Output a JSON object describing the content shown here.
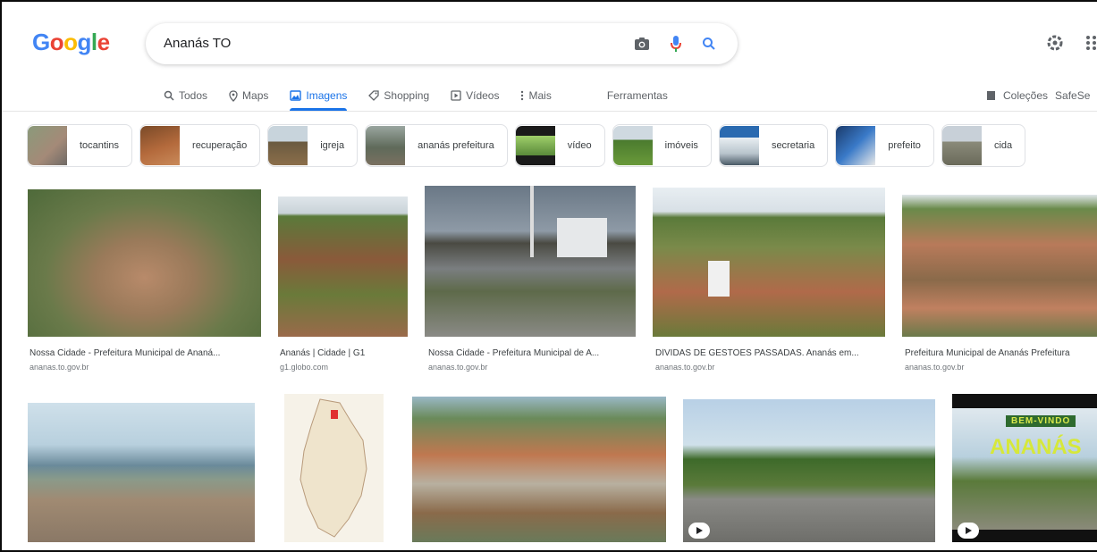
{
  "logo": {
    "letters": [
      "G",
      "o",
      "o",
      "g",
      "l",
      "e"
    ],
    "colors": [
      "#4285f4",
      "#ea4335",
      "#fbbc05",
      "#4285f4",
      "#34a853",
      "#ea4335"
    ]
  },
  "search": {
    "value": "Ananás TO"
  },
  "icons": {
    "camera": "camera-icon",
    "mic": "mic-icon",
    "search": "search-icon",
    "settings": "gear-icon",
    "apps": "apps-grid-icon"
  },
  "tabs": [
    {
      "label": "Todos",
      "icon": "search-icon",
      "active": false
    },
    {
      "label": "Maps",
      "icon": "map-pin-icon",
      "active": false
    },
    {
      "label": "Imagens",
      "icon": "image-icon",
      "active": true
    },
    {
      "label": "Shopping",
      "icon": "tag-icon",
      "active": false
    },
    {
      "label": "Vídeos",
      "icon": "video-icon",
      "active": false
    },
    {
      "label": "Mais",
      "icon": "more-icon",
      "active": false
    }
  ],
  "tools_label": "Ferramentas",
  "collections_label": "Coleções",
  "safesearch_label": "SafeSe",
  "chips": [
    {
      "label": "tocantins"
    },
    {
      "label": "recuperação"
    },
    {
      "label": "igreja"
    },
    {
      "label": "ananás prefeitura"
    },
    {
      "label": "vídeo"
    },
    {
      "label": "imóveis"
    },
    {
      "label": "secretaria"
    },
    {
      "label": "prefeito"
    },
    {
      "label": "cida"
    }
  ],
  "results_row1": [
    {
      "title": "Nossa Cidade - Prefeitura Municipal de Ananá...",
      "source": "ananas.to.gov.br"
    },
    {
      "title": "Ananás | Cidade | G1",
      "source": "g1.globo.com"
    },
    {
      "title": "Nossa Cidade - Prefeitura Municipal de A...",
      "source": "ananas.to.gov.br"
    },
    {
      "title": "DÍVIDAS DE GESTÕES PASSADAS. Ananás em...",
      "source": "ananas.to.gov.br"
    },
    {
      "title": "Prefeitura Municipal de Ananás Prefeitura",
      "source": "ananas.to.gov.br"
    }
  ],
  "video_banner": {
    "line1": "BEM-VINDO",
    "line2": "ANANÁS"
  }
}
